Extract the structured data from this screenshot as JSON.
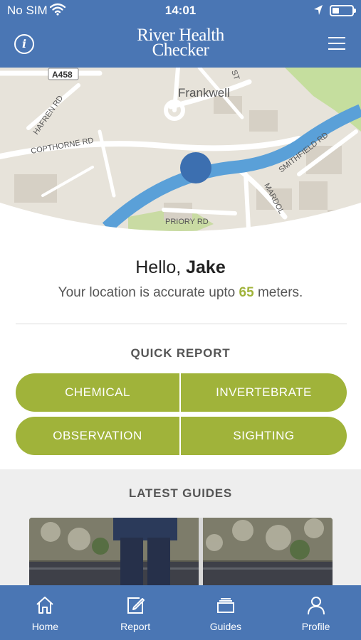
{
  "status_bar": {
    "carrier": "No SIM",
    "time": "14:01"
  },
  "header": {
    "title_line1": "River Health",
    "title_line2": "Checker"
  },
  "map": {
    "labels": {
      "road_a458": "A458",
      "frankwell": "Frankwell",
      "hafren_rd": "HAFREN RD",
      "copthorne_rd": "COPTHORNE RD",
      "smithfield_rd": "SMITHFIELD RD",
      "mardol": "MARDOL",
      "priory_rd": "PRIORY RD",
      "st": "ST"
    }
  },
  "greeting": {
    "hello": "Hello,",
    "name": "Jake"
  },
  "accuracy": {
    "prefix": "Your location is accurate upto",
    "value": "65",
    "suffix": "meters."
  },
  "quick_report": {
    "title": "QUICK REPORT",
    "buttons": [
      "CHEMICAL",
      "INVERTEBRATE",
      "OBSERVATION",
      "SIGHTING"
    ]
  },
  "latest_guides": {
    "title": "LATEST GUIDES"
  },
  "tabs": [
    {
      "label": "Home",
      "icon": "home-icon"
    },
    {
      "label": "Report",
      "icon": "edit-icon"
    },
    {
      "label": "Guides",
      "icon": "stack-icon"
    },
    {
      "label": "Profile",
      "icon": "person-icon"
    }
  ],
  "colors": {
    "brand_blue": "#4a76b4",
    "accent_green": "#a0b33a",
    "river": "#5aa0d8",
    "location_dot": "#3c6fb0"
  }
}
